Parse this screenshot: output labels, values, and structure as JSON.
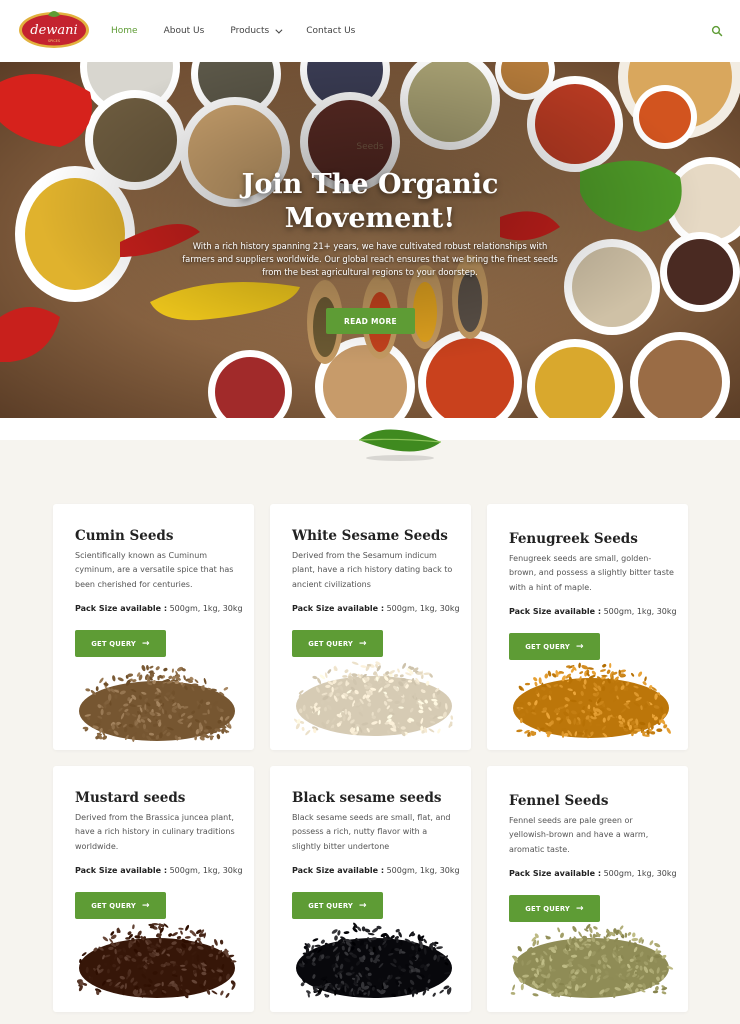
{
  "header": {
    "logo_text": "dewani",
    "logo_sub": "SPICES",
    "nav": [
      {
        "label": "Home",
        "active": true
      },
      {
        "label": "About Us",
        "active": false
      },
      {
        "label": "Products",
        "active": false,
        "dropdown": true
      },
      {
        "label": "Contact Us",
        "active": false
      }
    ],
    "search_icon": "search-icon"
  },
  "hero": {
    "tagline": "Seeds",
    "title": "Join The Organic Movement!",
    "description": "With a rich history spanning 21+ years, we have cultivated robust relationships with farmers and suppliers worldwide. Our global reach ensures that we bring the finest seeds from the best agricultural regions to your doorstep.",
    "button_label": "READ MORE"
  },
  "products": [
    {
      "name": "Cumin Seeds",
      "description": "Scientifically known as Cuminum cyminum, are a versatile spice that has been cherished for centuries.",
      "pack_label": "Pack Size available :",
      "pack_sizes": " 500gm, 1kg, 30kg",
      "button_label": "GET QUERY",
      "seed_color": "#8a6a45"
    },
    {
      "name": "White Sesame Seeds",
      "description": "Derived from the Sesamum indicum plant, have a rich history dating back to ancient civilizations",
      "pack_label": "Pack Size available :",
      "pack_sizes": " 500gm, 1kg, 30kg",
      "button_label": "GET QUERY",
      "seed_color": "#eadfc8"
    },
    {
      "name": "Fenugreek Seeds",
      "description": "Fenugreek seeds are small, golden-brown, and possess a slightly bitter taste with a hint of maple.",
      "pack_label": "Pack Size available :",
      "pack_sizes": " 500gm, 1kg, 30kg",
      "button_label": "GET QUERY",
      "seed_color": "#d08a1e"
    },
    {
      "name": "Mustard seeds",
      "description": "Derived from the Brassica juncea plant, have a rich history in culinary traditions worldwide.",
      "pack_label": "Pack Size available :",
      "pack_sizes": " 500gm, 1kg, 30kg",
      "button_label": "GET QUERY",
      "seed_color": "#4a2a1c"
    },
    {
      "name": "Black sesame seeds",
      "description": "Black sesame seeds are small, flat, and possess a rich, nutty flavor with a slightly bitter undertone",
      "pack_label": "Pack Size available :",
      "pack_sizes": " 500gm, 1kg, 30kg",
      "button_label": "GET QUERY",
      "seed_color": "#1c1c20"
    },
    {
      "name": "Fennel Seeds",
      "description": "Fennel seeds are pale green or yellowish-brown and have a warm, aromatic taste.",
      "pack_label": "Pack Size available :",
      "pack_sizes": " 500gm, 1kg, 30kg",
      "button_label": "GET QUERY",
      "seed_color": "#a3a06a"
    }
  ],
  "colors": {
    "accent": "#5e9c35",
    "logo_red": "#c4232f",
    "logo_gold": "#e2b23e",
    "page_bg": "#f6f4ef"
  }
}
